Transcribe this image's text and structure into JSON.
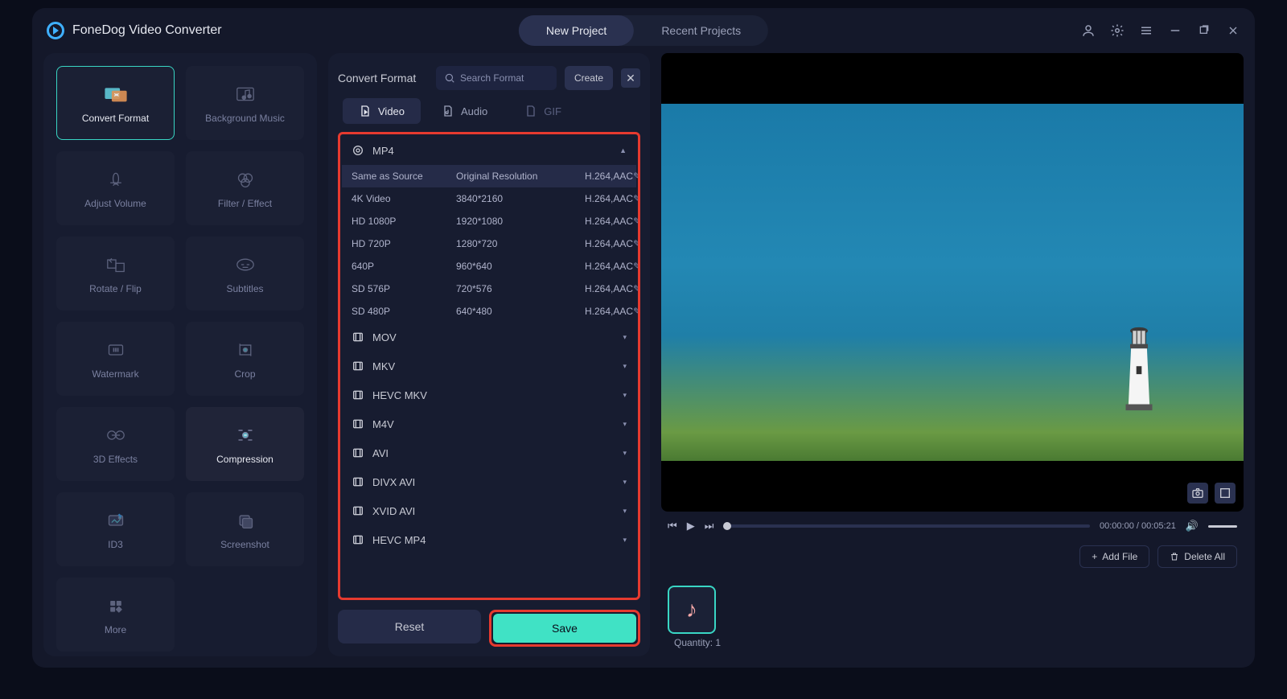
{
  "app": {
    "title": "FoneDog Video Converter"
  },
  "topTabs": {
    "new": "New Project",
    "recent": "Recent Projects"
  },
  "tools": [
    {
      "label": "Convert Format",
      "key": "convert-format",
      "active": true
    },
    {
      "label": "Background Music",
      "key": "background-music"
    },
    {
      "label": "Adjust Volume",
      "key": "adjust-volume"
    },
    {
      "label": "Filter / Effect",
      "key": "filter-effect"
    },
    {
      "label": "Rotate / Flip",
      "key": "rotate-flip"
    },
    {
      "label": "Subtitles",
      "key": "subtitles"
    },
    {
      "label": "Watermark",
      "key": "watermark"
    },
    {
      "label": "Crop",
      "key": "crop"
    },
    {
      "label": "3D Effects",
      "key": "3d-effects"
    },
    {
      "label": "Compression",
      "key": "compression",
      "hover": true
    },
    {
      "label": "ID3",
      "key": "id3"
    },
    {
      "label": "Screenshot",
      "key": "screenshot"
    },
    {
      "label": "More",
      "key": "more"
    }
  ],
  "center": {
    "title": "Convert Format",
    "searchPlaceholder": "Search Format",
    "createLabel": "Create",
    "tabs": {
      "video": "Video",
      "audio": "Audio",
      "gif": "GIF"
    }
  },
  "formats": {
    "mp4": {
      "label": "MP4",
      "header": {
        "name": "Same as Source",
        "res": "Original Resolution",
        "codec": "H.264,AAC"
      },
      "rows": [
        {
          "name": "4K Video",
          "res": "3840*2160",
          "codec": "H.264,AAC"
        },
        {
          "name": "HD 1080P",
          "res": "1920*1080",
          "codec": "H.264,AAC"
        },
        {
          "name": "HD 720P",
          "res": "1280*720",
          "codec": "H.264,AAC"
        },
        {
          "name": "640P",
          "res": "960*640",
          "codec": "H.264,AAC"
        },
        {
          "name": "SD 576P",
          "res": "720*576",
          "codec": "H.264,AAC"
        },
        {
          "name": "SD 480P",
          "res": "640*480",
          "codec": "H.264,AAC"
        }
      ]
    },
    "others": [
      {
        "label": "MOV"
      },
      {
        "label": "MKV"
      },
      {
        "label": "HEVC MKV"
      },
      {
        "label": "M4V"
      },
      {
        "label": "AVI"
      },
      {
        "label": "DIVX AVI"
      },
      {
        "label": "XVID AVI"
      },
      {
        "label": "HEVC MP4"
      }
    ]
  },
  "buttons": {
    "reset": "Reset",
    "save": "Save"
  },
  "player": {
    "time": "00:00:00 / 00:05:21"
  },
  "files": {
    "addFile": "Add File",
    "deleteAll": "Delete All",
    "quantity": "Quantity: 1"
  }
}
